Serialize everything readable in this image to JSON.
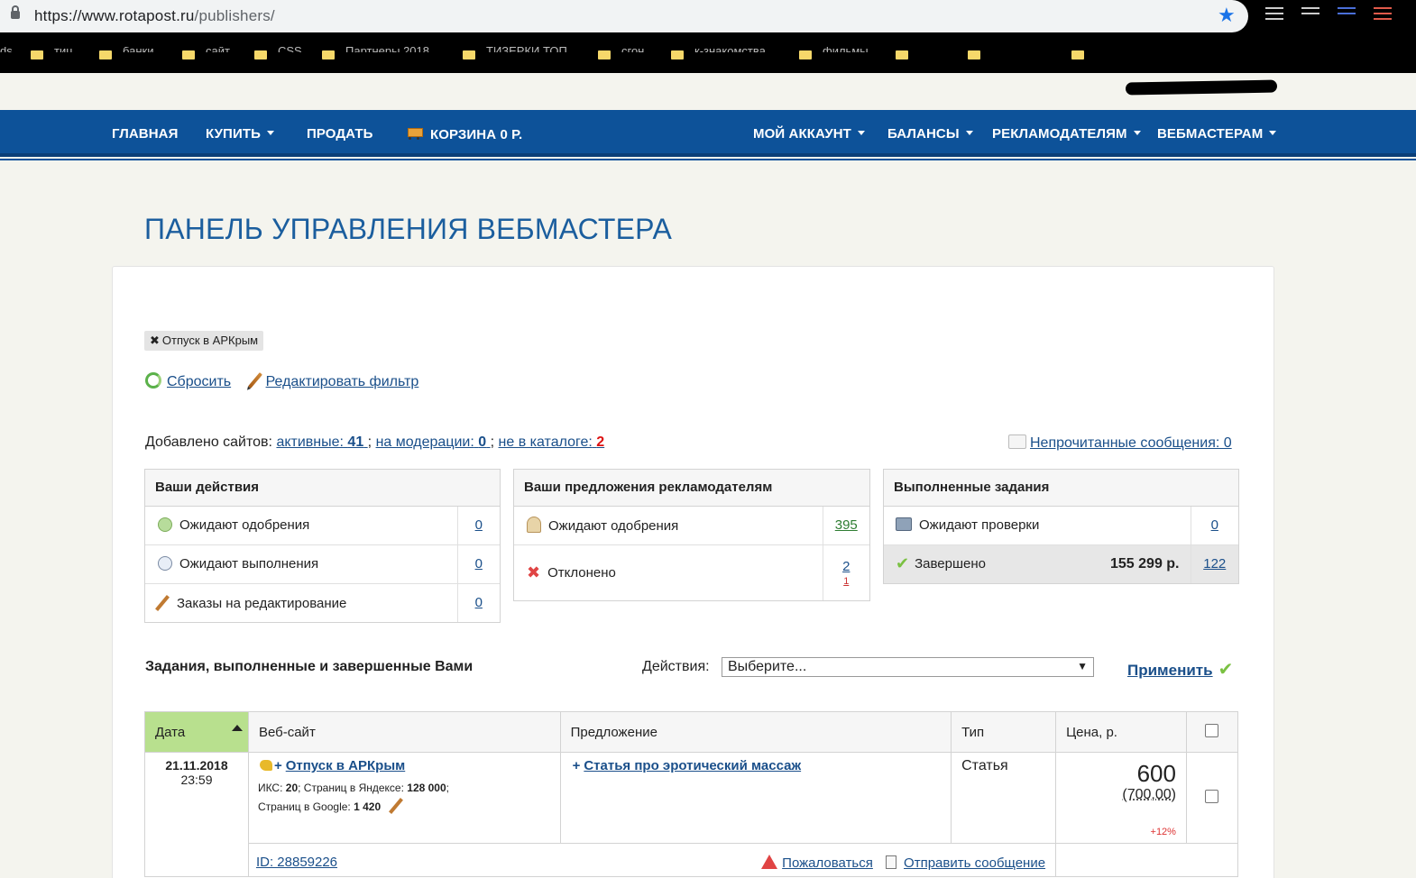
{
  "browser": {
    "url_prefix": "https://www.rotapost.ru",
    "url_path": "/publishers/",
    "bookmarks": [
      "ds",
      "тиц",
      "банки",
      "сайт",
      "CSS",
      "Партнеры 2018",
      "ТИЗЕРКИ ТОП",
      "сгон",
      "к-знакомства",
      "фильмы"
    ]
  },
  "nav": {
    "home": "ГЛАВНАЯ",
    "buy": "КУПИТЬ",
    "sell": "ПРОДАТЬ",
    "cart": "КОРЗИНА 0 Р.",
    "account": "МОЙ АККАУНТ",
    "balances": "БАЛАНСЫ",
    "advertisers": "РЕКЛАМОДАТЕЛЯМ",
    "webmasters": "ВЕБМАСТЕРАМ"
  },
  "page": {
    "title": "ПАНЕЛЬ УПРАВЛЕНИЯ ВЕБМАСТЕРА",
    "filter_tag": "Отпуск в АРКрым",
    "reset": "Сбросить",
    "edit_filter": "Редактировать фильтр"
  },
  "sites": {
    "label": "Добавлено сайтов:",
    "active_label": "активные:",
    "active_count": "41",
    "moderation_label": "на модерации:",
    "moderation_count": "0",
    "not_in_catalog_label": "не в каталоге:",
    "not_in_catalog_count": "2",
    "unread_messages": "Непрочитанные сообщения: 0"
  },
  "your_actions": {
    "title": "Ваши действия",
    "rows": [
      {
        "label": "Ожидают одобрения",
        "count": "0"
      },
      {
        "label": "Ожидают выполнения",
        "count": "0"
      },
      {
        "label": "Заказы на редактирование",
        "count": "0"
      }
    ]
  },
  "offers": {
    "title": "Ваши предложения рекламодателям",
    "rows": [
      {
        "label": "Ожидают одобрения",
        "count": "395"
      },
      {
        "label": "Отклонено",
        "count": "2",
        "sub": "1"
      }
    ]
  },
  "completed": {
    "title": "Выполненные задания",
    "rows": [
      {
        "label": "Ожидают проверки",
        "count": "0"
      },
      {
        "label": "Завершено",
        "amount": "155 299 р.",
        "count": "122"
      }
    ]
  },
  "tasks": {
    "title": "Задания, выполненные и завершенные Вами",
    "actions_label": "Действия:",
    "select_value": "Выберите...",
    "apply": "Применить",
    "columns": [
      "Дата",
      "Веб-сайт",
      "Предложение",
      "Тип",
      "Цена, р."
    ],
    "rows": [
      {
        "date": "21.11.2018",
        "time": "23:59",
        "site": "Отпуск в АРКрым",
        "iks_label": "ИКС:",
        "iks": "20",
        "yandex_label": "; Страниц в Яндексе:",
        "yandex": "128 000",
        "google_label": "Страниц в Google:",
        "google": "1 420",
        "offer": "Статья про эротический массаж",
        "type": "Статья",
        "price": "600",
        "old_price": "(700,00)",
        "pct": "+12%",
        "id": "ID: 28859226",
        "complain": "Пожаловаться",
        "send_message": "Отправить сообщение"
      }
    ]
  }
}
